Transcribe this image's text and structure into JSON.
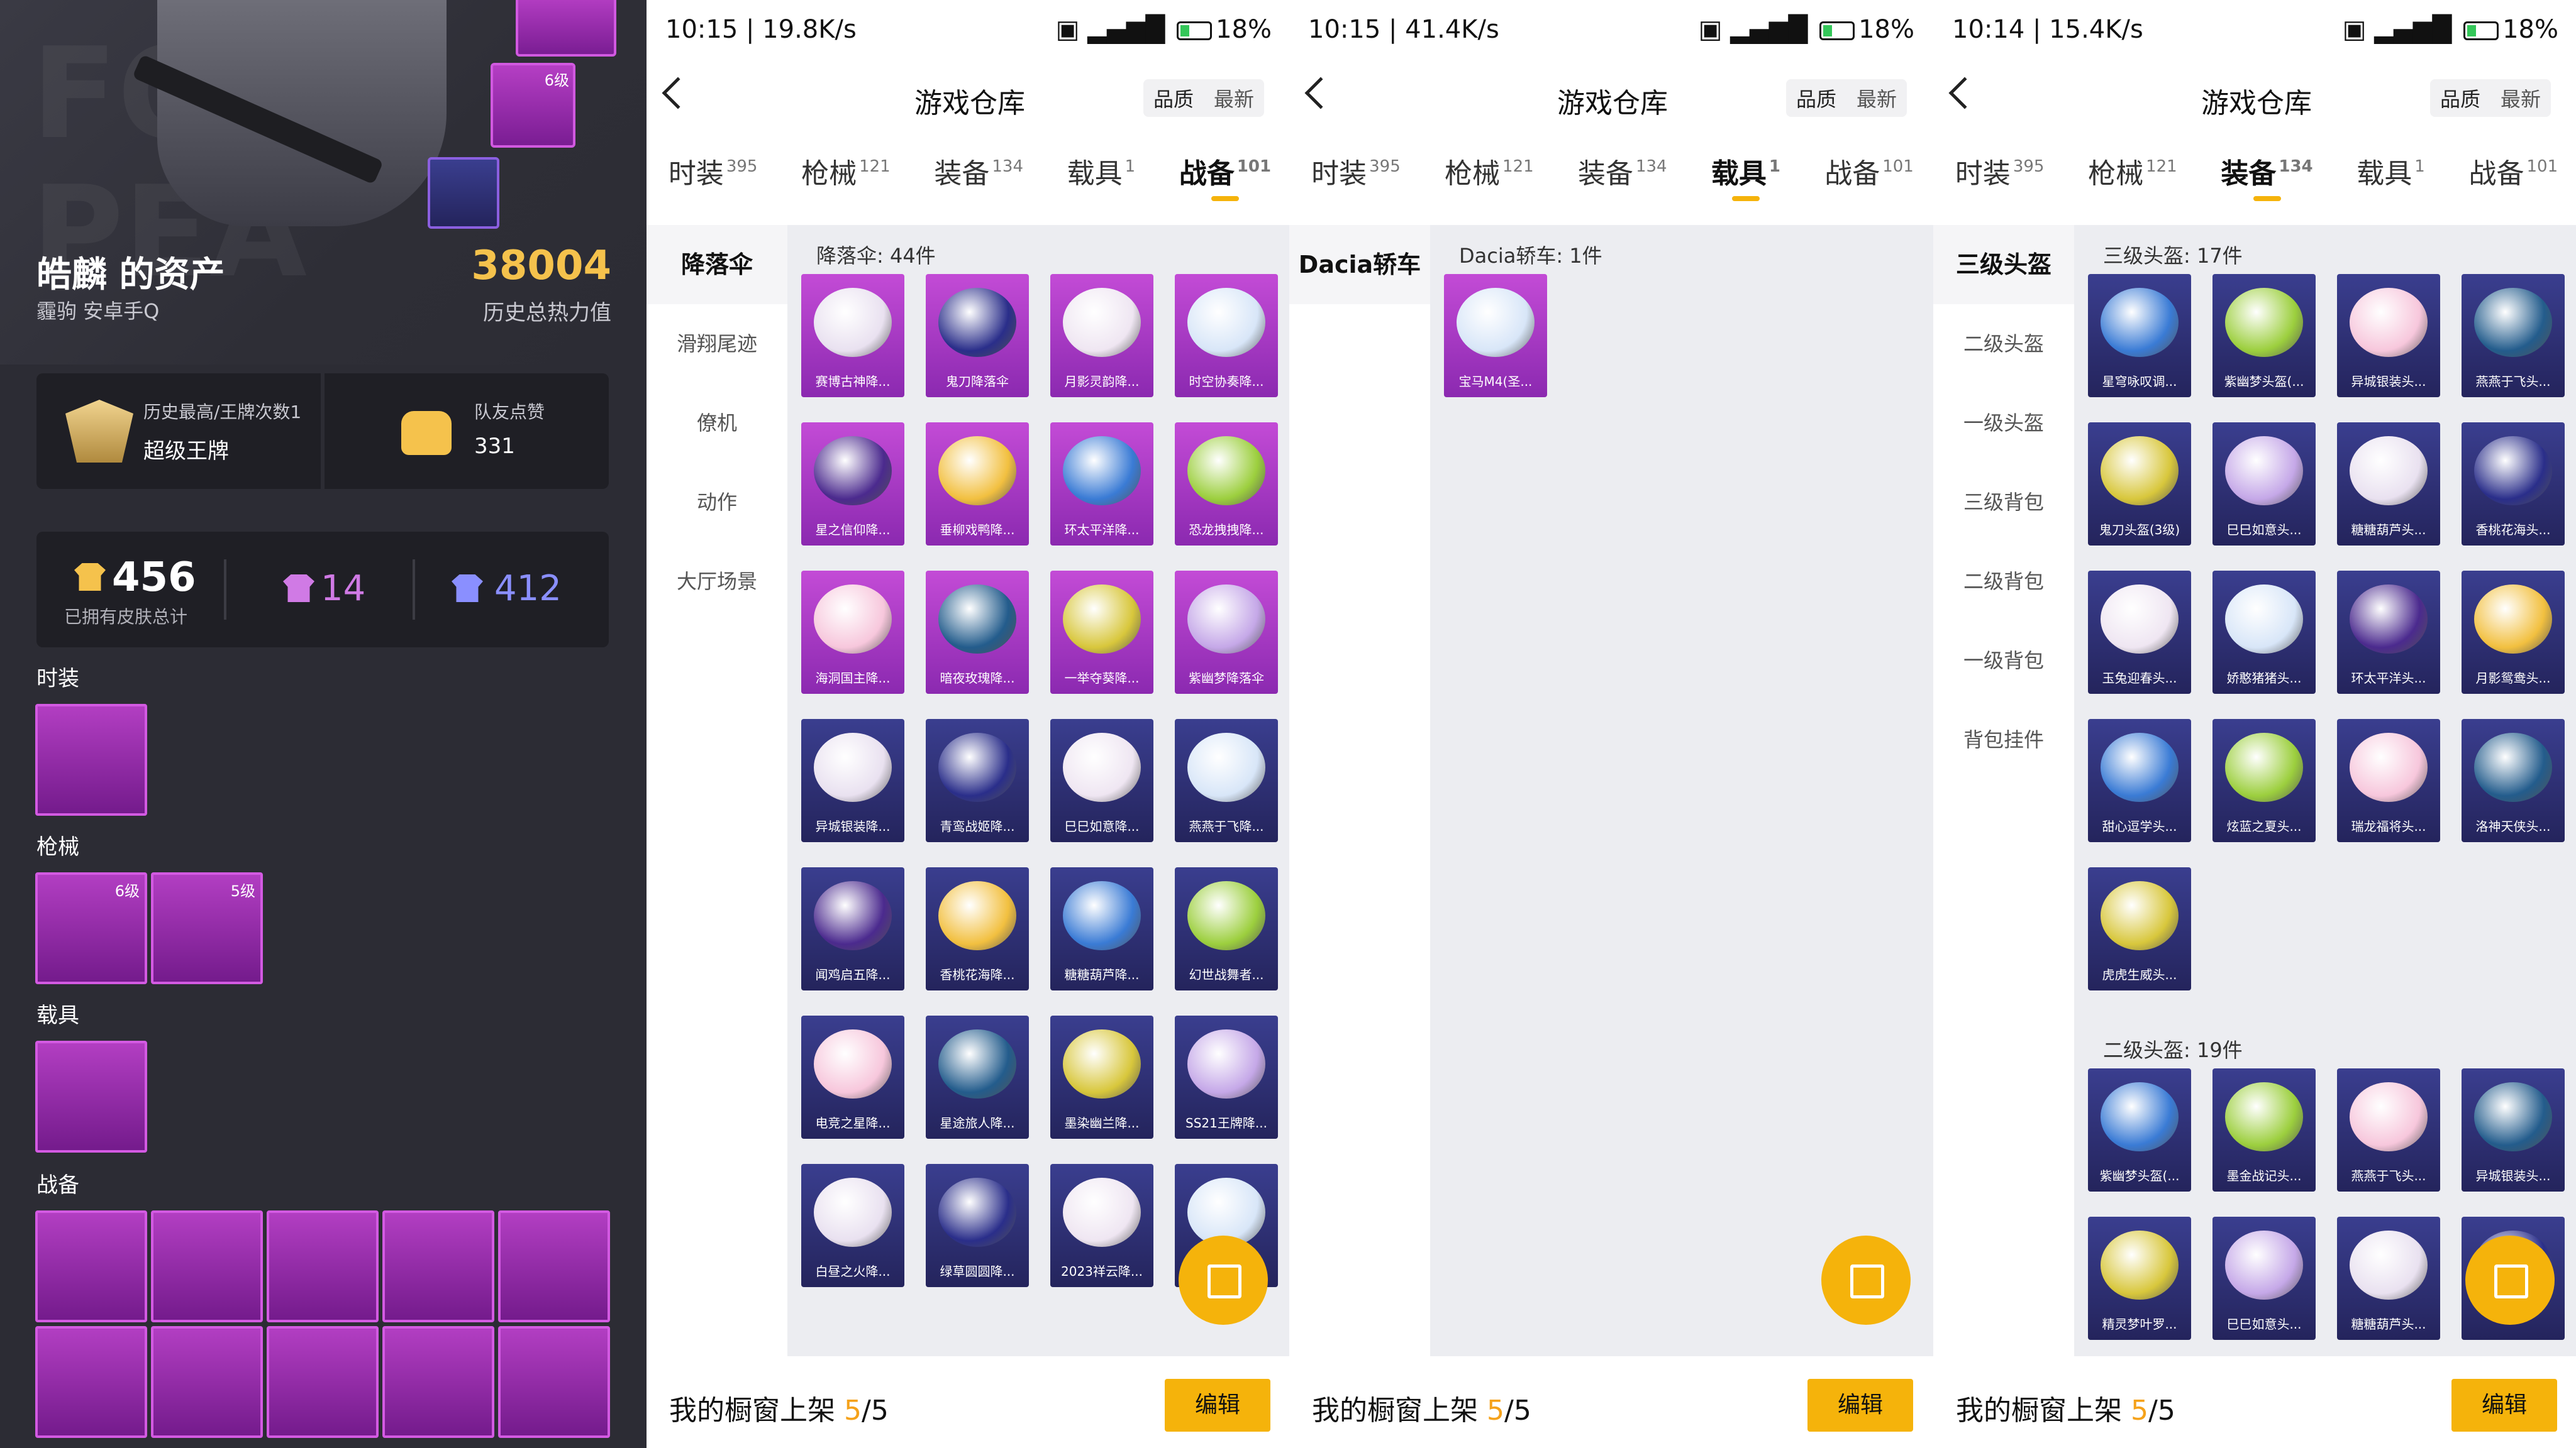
{
  "profile": {
    "owner": "皓麟 的资产",
    "sub": "霾驹   安卓手Q",
    "heat": "38004",
    "heat_label": "历史总热力值",
    "honor_title": "历史最高/王牌次数1",
    "honor_value": "超级王牌",
    "likes_title": "队友点赞",
    "likes_value": "331",
    "skins_total": "456",
    "skins_total_label": "已拥有皮肤总计",
    "skins_purple": "14",
    "skins_blue": "412",
    "sections": [
      "时装",
      "枪械",
      "载具",
      "战备"
    ],
    "hero_level": "6级",
    "gun_levels": [
      "6级",
      "5级"
    ]
  },
  "phones": [
    {
      "time": "10:15 | 19.8K/s",
      "battery": "18",
      "title": "游戏仓库",
      "sort": [
        "品质",
        "最新"
      ],
      "tabs": [
        {
          "label": "时装",
          "count": "395"
        },
        {
          "label": "枪械",
          "count": "121"
        },
        {
          "label": "装备",
          "count": "134"
        },
        {
          "label": "载具",
          "count": "1"
        },
        {
          "label": "战备",
          "count": "101"
        }
      ],
      "active_tab": 4,
      "side": [
        "降落伞",
        "滑翔尾迹",
        "僚机",
        "动作",
        "大厅场景"
      ],
      "groups": [
        {
          "label": "降落伞: 44件",
          "items": [
            "赛博古神降...",
            "鬼刀降落伞",
            "月影灵韵降...",
            "时空协奏降...",
            "星之信仰降...",
            "垂柳戏鸭降...",
            "环太平洋降...",
            "恐龙拽拽降...",
            "海洞国主降...",
            "暗夜玫瑰降...",
            "一举夺葵降...",
            "紫幽梦降落伞",
            "异城银装降...",
            "青鸾战姬降...",
            "巳巳如意降...",
            "燕燕于飞降...",
            "闻鸡启五降...",
            "香桃花海降...",
            "糖糖葫芦降...",
            "幻世战舞者...",
            "电竞之星降...",
            "星途旅人降...",
            "墨染幽兰降...",
            "SS21王牌降...",
            "白昼之火降...",
            "绿草圆圆降...",
            "2023祥云降...",
            ""
          ]
        }
      ],
      "bottom_label": "我的橱窗上架",
      "bottom_num": "5",
      "bottom_den": "/5",
      "edit": "编辑"
    },
    {
      "time": "10:15 | 41.4K/s",
      "battery": "18",
      "title": "游戏仓库",
      "sort": [
        "品质",
        "最新"
      ],
      "tabs": [
        {
          "label": "时装",
          "count": "395"
        },
        {
          "label": "枪械",
          "count": "121"
        },
        {
          "label": "装备",
          "count": "134"
        },
        {
          "label": "载具",
          "count": "1"
        },
        {
          "label": "战备",
          "count": "101"
        }
      ],
      "active_tab": 3,
      "side": [
        "Dacia轿车"
      ],
      "groups": [
        {
          "label": "Dacia轿车: 1件",
          "items": [
            "宝马M4(圣..."
          ]
        }
      ],
      "bottom_label": "我的橱窗上架",
      "bottom_num": "5",
      "bottom_den": "/5",
      "edit": "编辑"
    },
    {
      "time": "10:14 | 15.4K/s",
      "battery": "18",
      "title": "游戏仓库",
      "sort": [
        "品质",
        "最新"
      ],
      "tabs": [
        {
          "label": "时装",
          "count": "395"
        },
        {
          "label": "枪械",
          "count": "121"
        },
        {
          "label": "装备",
          "count": "134"
        },
        {
          "label": "载具",
          "count": "1"
        },
        {
          "label": "战备",
          "count": "101"
        }
      ],
      "active_tab": 2,
      "side": [
        "三级头盔",
        "二级头盔",
        "一级头盔",
        "三级背包",
        "二级背包",
        "一级背包",
        "背包挂件"
      ],
      "groups": [
        {
          "label": "三级头盔: 17件",
          "items": [
            "星穹咏叹调...",
            "紫幽梦头盔(...",
            "异城银装头...",
            "燕燕于飞头...",
            "鬼刀头盔(3级)",
            "巳巳如意头...",
            "糖糖葫芦头...",
            "香桃花海头...",
            "玉兔迎春头...",
            "娇憨猪猪头...",
            "环太平洋头...",
            "月影鸳鸯头...",
            "甜心逗学头...",
            "炫蓝之夏头...",
            "瑞龙福将头...",
            "洛神天侠头...",
            "虎虎生威头..."
          ]
        },
        {
          "label": "二级头盔: 19件",
          "items": [
            "紫幽梦头盔(...",
            "墨金战记头...",
            "燕燕于飞头...",
            "异城银装头...",
            "精灵梦叶罗...",
            "巳巳如意头...",
            "糖糖葫芦头...",
            ""
          ]
        }
      ],
      "bottom_label": "我的橱窗上架",
      "bottom_num": "5",
      "bottom_den": "/5",
      "edit": "编辑"
    }
  ],
  "colors": {
    "accent": "#f5b30b",
    "purple": "#b23ec2",
    "blue_tile": "#2e3070"
  }
}
